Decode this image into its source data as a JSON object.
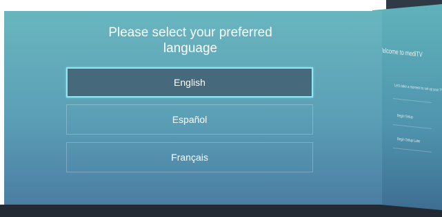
{
  "heading": {
    "line1": "Please select your preferred",
    "line2": "language"
  },
  "languages": [
    {
      "label": "English",
      "selected": true
    },
    {
      "label": "Español",
      "selected": false
    },
    {
      "label": "Français",
      "selected": false
    }
  ],
  "side_panel": {
    "title": "Welcome to mediTV",
    "subtitle": "Let's take a moment to set up your TV",
    "options": [
      "Begin Setup",
      "Begin Setup Later"
    ]
  },
  "colors": {
    "panel_top": "#69b6bf",
    "panel_bottom": "#4b7ea3",
    "selected_bg": "#47697c",
    "selected_border": "#8fe8f2"
  }
}
